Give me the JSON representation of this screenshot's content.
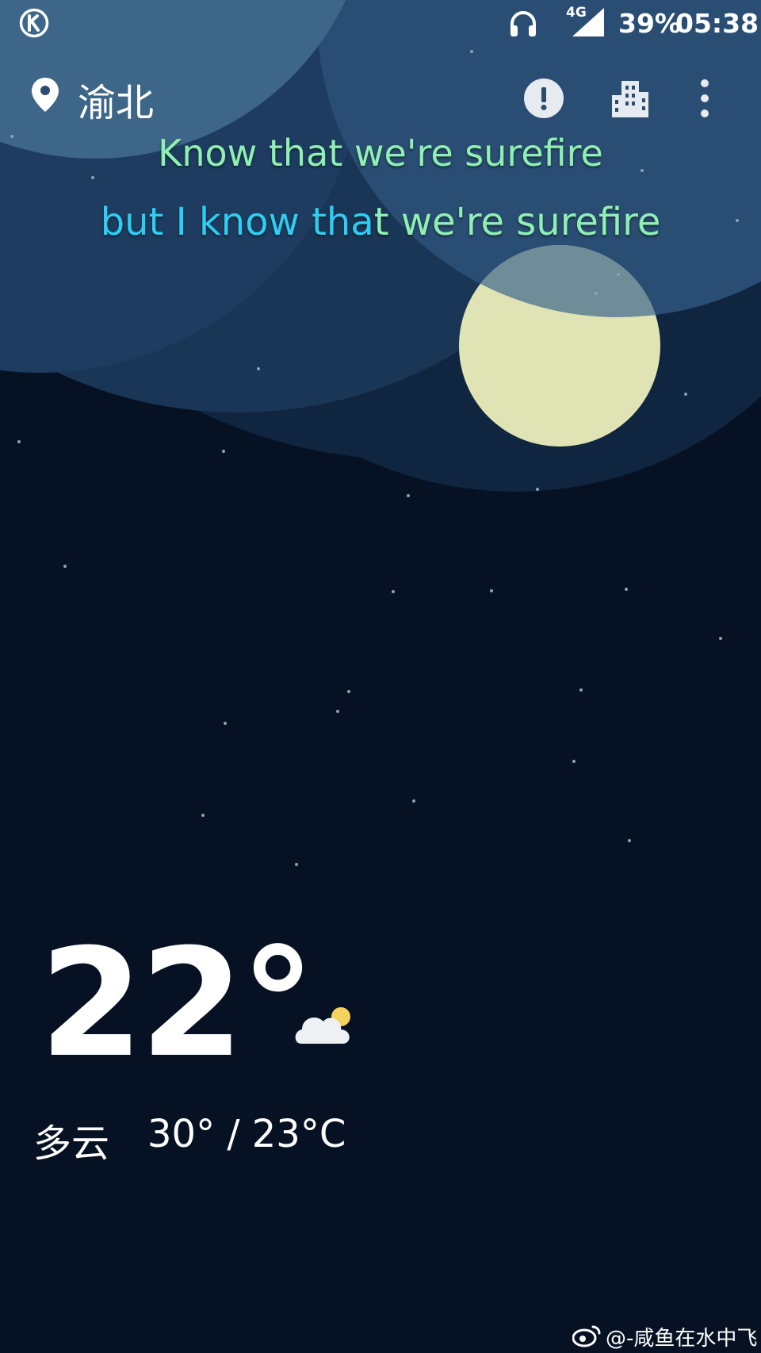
{
  "status_bar": {
    "network": "4G",
    "battery": "39%",
    "time": "05:38",
    "icons": [
      "k-app-icon",
      "headset-icon",
      "signal-icon"
    ]
  },
  "header": {
    "location": "渝北",
    "icons": [
      "location-pin-icon",
      "alert-icon",
      "city-icon",
      "more-vert-icon"
    ]
  },
  "lyrics": {
    "line1": "Know that we're surefire",
    "line2_sung": "but I know tha",
    "line2_rest": "t we're surefire",
    "colors": {
      "sung": "#2ecdf2",
      "unsung": "#8ff0b2"
    }
  },
  "weather": {
    "temperature": "22°",
    "condition": "多云",
    "range": "30° / 23°C",
    "icon": "partly-cloudy-night-icon"
  },
  "watermark": {
    "text": "@-咸鱼在水中飞",
    "icon": "weibo-icon"
  },
  "colors": {
    "background": "#061224",
    "moon": "#e0e4b4"
  }
}
